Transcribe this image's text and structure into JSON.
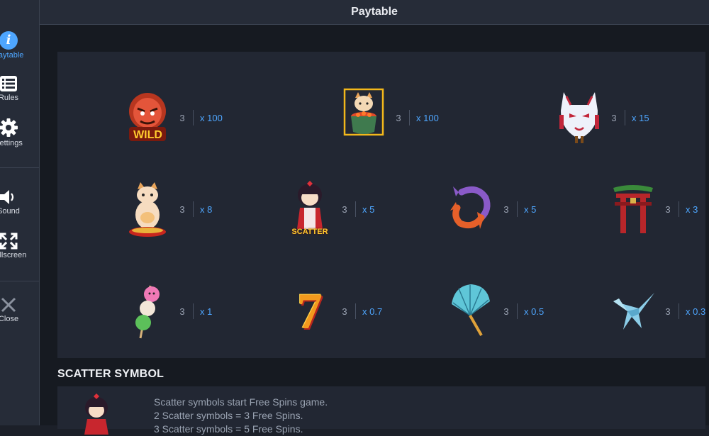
{
  "header": {
    "title": "Paytable"
  },
  "sidebar": {
    "items": [
      {
        "label": "Paytable",
        "icon": "info-icon",
        "active": true
      },
      {
        "label": "Rules",
        "icon": "list-icon"
      },
      {
        "label": "Settings",
        "icon": "gear-icon"
      },
      {
        "label": "Sound",
        "icon": "speaker-icon"
      },
      {
        "label": "Fullscreen",
        "icon": "fullscreen-icon"
      },
      {
        "label": "Close",
        "icon": "close-icon"
      }
    ]
  },
  "paytable": {
    "symbols": [
      {
        "name": "wild",
        "count": "3",
        "mult": "x 100",
        "badge": "WILD"
      },
      {
        "name": "cat-bowl",
        "count": "3",
        "mult": "x 100"
      },
      {
        "name": "kitsune-mask",
        "count": "3",
        "mult": "x 15"
      },
      {
        "name": "lucky-cat",
        "count": "3",
        "mult": "x 8"
      },
      {
        "name": "scatter-doll",
        "count": "3",
        "mult": "x 5",
        "badge": "SCATTER"
      },
      {
        "name": "koi-fish",
        "count": "3",
        "mult": "x 5"
      },
      {
        "name": "torii-gate",
        "count": "3",
        "mult": "x 3"
      },
      {
        "name": "dango",
        "count": "3",
        "mult": "x 1"
      },
      {
        "name": "seven",
        "count": "3",
        "mult": "x 0.7",
        "glyph": "7"
      },
      {
        "name": "fan",
        "count": "3",
        "mult": "x 0.5"
      },
      {
        "name": "paper-crane",
        "count": "3",
        "mult": "x 0.3"
      }
    ]
  },
  "scatter_section": {
    "title": "SCATTER SYMBOL",
    "lines": [
      "Scatter symbols start Free Spins game.",
      "2 Scatter symbols = 3 Free Spins.",
      "3 Scatter symbols = 5 Free Spins."
    ]
  },
  "colors": {
    "accent": "#4ea6ff",
    "panel": "#222733",
    "background": "#161a21"
  }
}
